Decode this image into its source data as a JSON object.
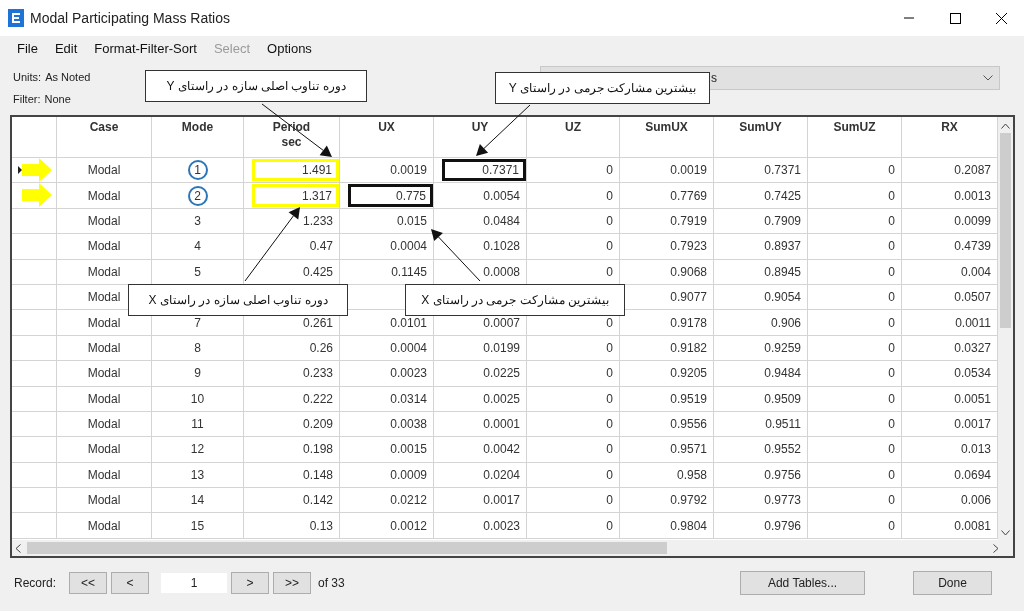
{
  "window": {
    "title": "Modal Participating Mass Ratios"
  },
  "menu": [
    {
      "label": "File",
      "disabled": false
    },
    {
      "label": "Edit",
      "disabled": false
    },
    {
      "label": "Format-Filter-Sort",
      "disabled": false
    },
    {
      "label": "Select",
      "disabled": true
    },
    {
      "label": "Options",
      "disabled": false
    }
  ],
  "info": [
    {
      "label": "Units:",
      "value": "As Noted"
    },
    {
      "label": "Filter:",
      "value": "None"
    }
  ],
  "dropdown": {
    "value": "s"
  },
  "table": {
    "columns": [
      "Case",
      "Mode",
      "Period\nsec",
      "UX",
      "UY",
      "UZ",
      "SumUX",
      "SumUY",
      "SumUZ",
      "RX"
    ],
    "rows": [
      {
        "current": true,
        "pointer": true,
        "cells": [
          "Modal",
          {
            "text": "1",
            "circled": true
          },
          {
            "text": "1.491",
            "color": "#ffff00"
          },
          "0.0019",
          {
            "text": "0.7371",
            "color": "#111111"
          },
          "0",
          "0.0019",
          "0.7371",
          "0",
          "0.2087"
        ]
      },
      {
        "current": false,
        "pointer": true,
        "cells": [
          "Modal",
          {
            "text": "2",
            "circled": true
          },
          {
            "text": "1.317",
            "color": "#ffff00"
          },
          {
            "text": "0.775",
            "color": "#111111"
          },
          "0.0054",
          "0",
          "0.7769",
          "0.7425",
          "0",
          "0.0013"
        ]
      },
      {
        "current": false,
        "pointer": false,
        "cells": [
          "Modal",
          "3",
          "1.233",
          "0.015",
          "0.0484",
          "0",
          "0.7919",
          "0.7909",
          "0",
          "0.0099"
        ]
      },
      {
        "current": false,
        "pointer": false,
        "cells": [
          "Modal",
          "4",
          "0.47",
          "0.0004",
          "0.1028",
          "0",
          "0.7923",
          "0.8937",
          "0",
          "0.4739"
        ]
      },
      {
        "current": false,
        "pointer": false,
        "cells": [
          "Modal",
          "5",
          "0.425",
          "0.1145",
          "0.0008",
          "0",
          "0.9068",
          "0.8945",
          "0",
          "0.004"
        ]
      },
      {
        "current": false,
        "pointer": false,
        "cells": [
          "Modal",
          null,
          null,
          null,
          null,
          null,
          "0.9077",
          "0.9054",
          "0",
          "0.0507"
        ]
      },
      {
        "current": false,
        "pointer": false,
        "cells": [
          "Modal",
          "7",
          "0.261",
          "0.0101",
          "0.0007",
          "0",
          "0.9178",
          "0.906",
          "0",
          "0.0011"
        ]
      },
      {
        "current": false,
        "pointer": false,
        "cells": [
          "Modal",
          "8",
          "0.26",
          "0.0004",
          "0.0199",
          "0",
          "0.9182",
          "0.9259",
          "0",
          "0.0327"
        ]
      },
      {
        "current": false,
        "pointer": false,
        "cells": [
          "Modal",
          "9",
          "0.233",
          "0.0023",
          "0.0225",
          "0",
          "0.9205",
          "0.9484",
          "0",
          "0.0534"
        ]
      },
      {
        "current": false,
        "pointer": false,
        "cells": [
          "Modal",
          "10",
          "0.222",
          "0.0314",
          "0.0025",
          "0",
          "0.9519",
          "0.9509",
          "0",
          "0.0051"
        ]
      },
      {
        "current": false,
        "pointer": false,
        "cells": [
          "Modal",
          "11",
          "0.209",
          "0.0038",
          "0.0001",
          "0",
          "0.9556",
          "0.9511",
          "0",
          "0.0017"
        ]
      },
      {
        "current": false,
        "pointer": false,
        "cells": [
          "Modal",
          "12",
          "0.198",
          "0.0015",
          "0.0042",
          "0",
          "0.9571",
          "0.9552",
          "0",
          "0.013"
        ]
      },
      {
        "current": false,
        "pointer": false,
        "cells": [
          "Modal",
          "13",
          "0.148",
          "0.0009",
          "0.0204",
          "0",
          "0.958",
          "0.9756",
          "0",
          "0.0694"
        ]
      },
      {
        "current": false,
        "pointer": false,
        "cells": [
          "Modal",
          "14",
          "0.142",
          "0.0212",
          "0.0017",
          "0",
          "0.9792",
          "0.9773",
          "0",
          "0.006"
        ]
      },
      {
        "current": false,
        "pointer": false,
        "cells": [
          "Modal",
          "15",
          "0.13",
          "0.0012",
          "0.0023",
          "0",
          "0.9804",
          "0.9796",
          "0",
          "0.0081"
        ]
      }
    ]
  },
  "callouts": [
    {
      "text": "بیشترین مشارکت جرمی در راستای Y"
    },
    {
      "text": "دوره تناوب اصلی سازه در راستای Y"
    },
    {
      "text": "بیشترین مشارکت جرمی در راستای X"
    },
    {
      "text": "دوره تناوب اصلی سازه در راستای X"
    }
  ],
  "record": {
    "label": "Record:",
    "back": [
      "<<",
      "<"
    ],
    "value": "1",
    "forward": [
      ">",
      ">>"
    ],
    "total": "of 33"
  },
  "buttons": [
    "Add Tables...",
    "Done"
  ]
}
